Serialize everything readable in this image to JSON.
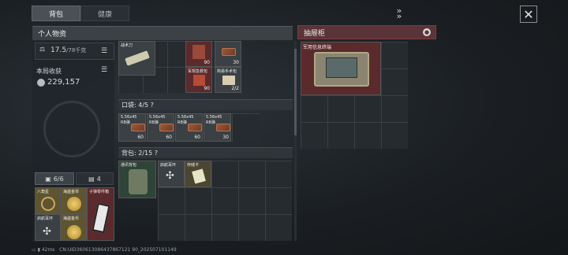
{
  "tabs": [
    {
      "label": "背包"
    },
    {
      "label": "健康"
    }
  ],
  "personal": {
    "title": "个人物资",
    "weight": "17.5",
    "weight_max": "/78千克",
    "income_label": "本局收获",
    "income_value": "229,157"
  },
  "top_items": [
    {
      "name": "战术刀",
      "count": ""
    },
    {
      "name": "",
      "count": "90"
    },
    {
      "name": "",
      "count": "30"
    },
    {
      "name": "军规急救包",
      "count": "90"
    },
    {
      "name": "简易手术包",
      "count": "2/2"
    }
  ],
  "pocket": {
    "label": "口袋: 4/5",
    "help": "?",
    "items": [
      {
        "name": "5.56x45",
        "sub": "RB弹",
        "count": "60"
      },
      {
        "name": "5.56x45",
        "sub": "RB弹",
        "count": "60"
      },
      {
        "name": "5.56x45",
        "sub": "RB弹",
        "count": "60"
      },
      {
        "name": "5.56x45",
        "sub": "RB弹",
        "count": "30"
      }
    ]
  },
  "backpack": {
    "label": "背包: 2/15",
    "help": "?",
    "items": [
      {
        "name": "通讯背包"
      },
      {
        "name": "启航耳环"
      },
      {
        "name": "存储卡"
      }
    ]
  },
  "equip_tabs": [
    {
      "label": "6/6"
    },
    {
      "label": "4"
    }
  ],
  "equip": [
    {
      "name": "八角星"
    },
    {
      "name": "海盗金币"
    },
    {
      "name": "子弹零件箱"
    },
    {
      "name": "启航耳环"
    },
    {
      "name": "海盗金币"
    }
  ],
  "cabinet": {
    "title": "抽屉柜",
    "item": "军用信息终端"
  },
  "footer": {
    "ping": "42ms",
    "id": "CN:UID360613086437867121 90_202507101149"
  },
  "colors": {
    "accent_red": "#5a3438",
    "item_red": "#5a2a2c",
    "item_gold": "#5e5430",
    "panel": "#2a2f33"
  }
}
